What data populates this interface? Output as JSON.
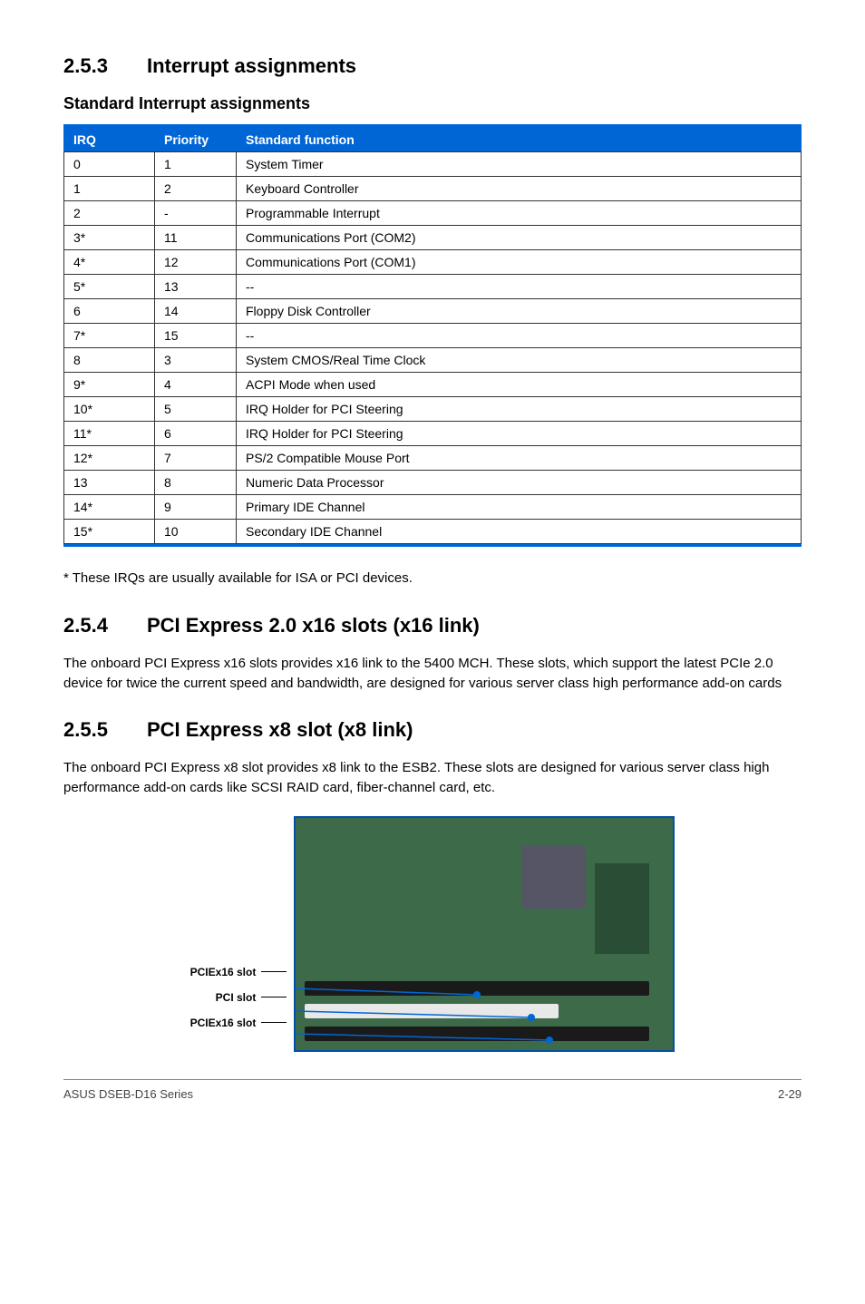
{
  "sections": {
    "interrupt": {
      "number": "2.5.3",
      "title": "Interrupt assignments",
      "subheading": "Standard Interrupt assignments",
      "footnote": "* These IRQs are usually available for ISA or PCI devices."
    },
    "pcie16": {
      "number": "2.5.4",
      "title": "PCI Express 2.0 x16 slots (x16 link)",
      "body": "The onboard PCI Express x16 slots provides x16 link to the 5400 MCH. These slots, which support the latest PCIe 2.0 device for twice the current speed and bandwidth, are designed for various server class high performance add-on cards"
    },
    "pcie8": {
      "number": "2.5.5",
      "title": "PCI Express x8 slot (x8 link)",
      "body": "The onboard PCI Express x8 slot provides x8 link to the ESB2. These slots are designed for various server class high performance add-on cards like SCSI RAID card, fiber-channel card, etc."
    }
  },
  "table": {
    "headers": {
      "irq": "IRQ",
      "priority": "Priority",
      "func": "Standard function"
    },
    "rows": [
      {
        "irq": "0",
        "priority": "1",
        "func": "System Timer"
      },
      {
        "irq": "1",
        "priority": "2",
        "func": "Keyboard Controller"
      },
      {
        "irq": "2",
        "priority": "-",
        "func": "Programmable Interrupt"
      },
      {
        "irq": "3*",
        "priority": "11",
        "func": "Communications Port (COM2)"
      },
      {
        "irq": "4*",
        "priority": "12",
        "func": "Communications Port (COM1)"
      },
      {
        "irq": "5*",
        "priority": "13",
        "func": "--"
      },
      {
        "irq": "6",
        "priority": "14",
        "func": "Floppy Disk Controller"
      },
      {
        "irq": "7*",
        "priority": "15",
        "func": "--"
      },
      {
        "irq": "8",
        "priority": "3",
        "func": "System CMOS/Real Time Clock"
      },
      {
        "irq": "9*",
        "priority": "4",
        "func": "ACPI Mode when used"
      },
      {
        "irq": "10*",
        "priority": "5",
        "func": "IRQ Holder for PCI Steering"
      },
      {
        "irq": "11*",
        "priority": "6",
        "func": "IRQ Holder for PCI Steering"
      },
      {
        "irq": "12*",
        "priority": "7",
        "func": "PS/2 Compatible Mouse Port"
      },
      {
        "irq": "13",
        "priority": "8",
        "func": "Numeric Data Processor"
      },
      {
        "irq": "14*",
        "priority": "9",
        "func": "Primary IDE Channel"
      },
      {
        "irq": "15*",
        "priority": "10",
        "func": "Secondary IDE Channel"
      }
    ]
  },
  "image_labels": {
    "slot1": "PCIEx16 slot",
    "slot2": "PCI slot",
    "slot3": "PCIEx16 slot"
  },
  "footer": {
    "left": "ASUS DSEB-D16 Series",
    "right": "2-29"
  }
}
